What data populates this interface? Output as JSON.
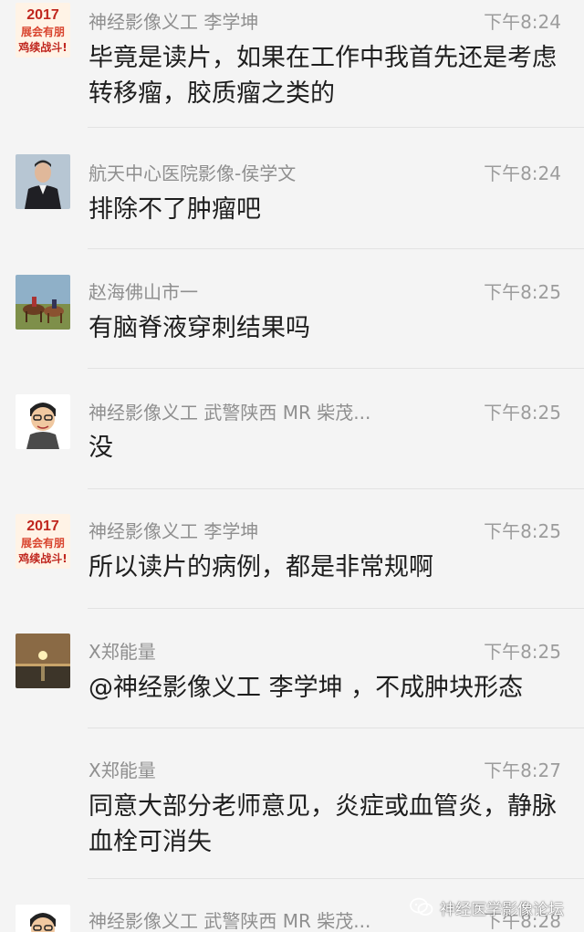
{
  "colors": {
    "background": "#f4f4f4",
    "sender": "#8f8f8f",
    "time": "#9c9c9c",
    "message": "#1e1e1e",
    "separator": "#e2e2e2"
  },
  "messages": [
    {
      "sender": "神经影像义工 李学坤",
      "time": "下午8:24",
      "text": "毕竟是读片，如果在工作中我首先还是考虑转移瘤，胶质瘤之类的",
      "avatar": "badge-2017-avatar"
    },
    {
      "sender": "航天中心医院影像-侯学文",
      "time": "下午8:24",
      "text": "排除不了肿瘤吧",
      "avatar": "man-in-suit-avatar"
    },
    {
      "sender": "赵海佛山市一",
      "time": "下午8:25",
      "text": "有脑脊液穿刺结果吗",
      "avatar": "horse-riders-avatar"
    },
    {
      "sender": "神经影像义工 武警陕西 MR 柴茂...",
      "time": "下午8:25",
      "text": "没",
      "avatar": "cartoon-man-avatar"
    },
    {
      "sender": "神经影像义工 李学坤",
      "time": "下午8:25",
      "text": "所以读片的病例，都是非常规啊",
      "avatar": "badge-2017-avatar"
    },
    {
      "sender": "X郑能量",
      "time": "下午8:25",
      "text": "@神经影像义工 李学坤 ，不成肿块形态",
      "avatar": "sunset-avatar"
    },
    {
      "sender": "X郑能量",
      "time": "下午8:27",
      "text": "同意大部分老师意见，炎症或血管炎，静脉血栓可消失",
      "avatar": ""
    },
    {
      "sender": "神经影像义工 武警陕西 MR 柴茂...",
      "time": "下午8:28",
      "text": "",
      "avatar": "cartoon-man-avatar"
    }
  ],
  "avatar_badge_text": {
    "year": "2017",
    "line1": "展会有朋",
    "line2": "鸡续战斗!"
  },
  "watermark": {
    "icon": "wechat-icon",
    "text": "神经医学影像论坛"
  }
}
